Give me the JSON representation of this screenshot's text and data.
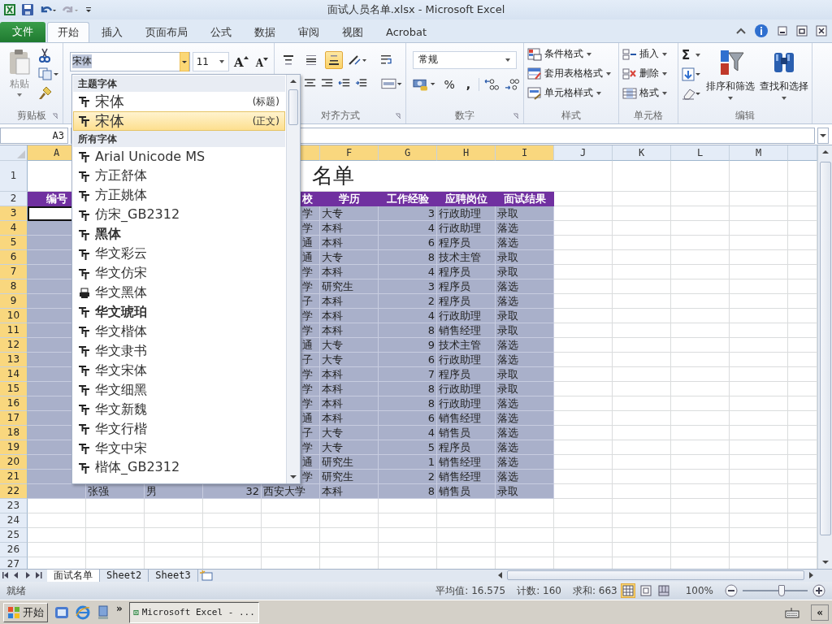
{
  "window": {
    "title": "面试人员名单.xlsx - Microsoft Excel"
  },
  "ribbon_tabs": [
    {
      "label": "文件",
      "kind": "file",
      "selected": false
    },
    {
      "label": "开始",
      "kind": "tab",
      "selected": true
    },
    {
      "label": "插入",
      "kind": "tab",
      "selected": false
    },
    {
      "label": "页面布局",
      "kind": "tab",
      "selected": false
    },
    {
      "label": "公式",
      "kind": "tab",
      "selected": false
    },
    {
      "label": "数据",
      "kind": "tab",
      "selected": false
    },
    {
      "label": "审阅",
      "kind": "tab",
      "selected": false
    },
    {
      "label": "视图",
      "kind": "tab",
      "selected": false
    },
    {
      "label": "Acrobat",
      "kind": "tab",
      "selected": false
    }
  ],
  "ribbon": {
    "clipboard": {
      "paste": "粘贴",
      "label": "剪贴板"
    },
    "font": {
      "name": "宋体",
      "size": "11",
      "grow": "A",
      "shrink": "A"
    },
    "alignment": {
      "label": "对齐方式",
      "vertical": [
        {
          "kind": "top",
          "selected": false
        },
        {
          "kind": "middle",
          "selected": false
        },
        {
          "kind": "bottom",
          "selected": true
        }
      ]
    },
    "number": {
      "label": "数字",
      "format": "常规",
      "percent": "%",
      "comma": ","
    },
    "styles": {
      "label": "样式",
      "buttons": [
        {
          "kind": "conditional",
          "label": "条件格式"
        },
        {
          "kind": "table",
          "label": "套用表格格式"
        },
        {
          "kind": "cell",
          "label": "单元格样式"
        }
      ]
    },
    "cells": {
      "label": "单元格",
      "buttons": [
        {
          "kind": "insert",
          "label": "插入"
        },
        {
          "kind": "delete",
          "label": "删除"
        },
        {
          "kind": "format",
          "label": "格式"
        }
      ]
    },
    "editing": {
      "label": "编辑",
      "sum": "Σ",
      "sort": "排序和筛选",
      "find": "查找和选择"
    }
  },
  "formula_bar": {
    "name_box": "A3"
  },
  "sheet": {
    "columns": [
      {
        "label": "A",
        "selected": true
      },
      {
        "label": "F",
        "selected": true
      },
      {
        "label": "G",
        "selected": true
      },
      {
        "label": "H",
        "selected": true
      },
      {
        "label": "I",
        "selected": true
      },
      {
        "label": "J",
        "selected": false
      },
      {
        "label": "K",
        "selected": false
      },
      {
        "label": "L",
        "selected": false
      },
      {
        "label": "M",
        "selected": false
      }
    ],
    "rows": [
      {
        "label": "1",
        "kind": "title",
        "selected": false,
        "title": "名单"
      },
      {
        "label": "2",
        "kind": "header",
        "selected": false,
        "number": "编号",
        "school": "校",
        "education": "学历",
        "experience": "工作经验",
        "position": "应聘岗位",
        "result": "面试结果"
      },
      {
        "label": "3",
        "kind": "data",
        "selected": true,
        "active": true,
        "school": "学",
        "education": "大专",
        "experience": "3",
        "position": "行政助理",
        "result": "录取"
      },
      {
        "label": "4",
        "kind": "data",
        "selected": true,
        "school": "学",
        "education": "本科",
        "experience": "4",
        "position": "行政助理",
        "result": "落选"
      },
      {
        "label": "5",
        "kind": "data",
        "selected": true,
        "school": "通",
        "education": "本科",
        "experience": "6",
        "position": "程序员",
        "result": "落选"
      },
      {
        "label": "6",
        "kind": "data",
        "selected": true,
        "school": "通",
        "education": "大专",
        "experience": "8",
        "position": "技术主管",
        "result": "录取"
      },
      {
        "label": "7",
        "kind": "data",
        "selected": true,
        "school": "学",
        "education": "本科",
        "experience": "4",
        "position": "程序员",
        "result": "录取"
      },
      {
        "label": "8",
        "kind": "data",
        "selected": true,
        "school": "学",
        "education": "研究生",
        "experience": "3",
        "position": "程序员",
        "result": "落选"
      },
      {
        "label": "9",
        "kind": "data",
        "selected": true,
        "school": "子",
        "education": "本科",
        "experience": "2",
        "position": "程序员",
        "result": "落选"
      },
      {
        "label": "10",
        "kind": "data",
        "selected": true,
        "school": "学",
        "education": "本科",
        "experience": "4",
        "position": "行政助理",
        "result": "录取"
      },
      {
        "label": "11",
        "kind": "data",
        "selected": true,
        "school": "学",
        "education": "本科",
        "experience": "8",
        "position": "销售经理",
        "result": "录取"
      },
      {
        "label": "12",
        "kind": "data",
        "selected": true,
        "school": "通",
        "education": "大专",
        "experience": "9",
        "position": "技术主管",
        "result": "落选"
      },
      {
        "label": "13",
        "kind": "data",
        "selected": true,
        "school": "子",
        "education": "大专",
        "experience": "6",
        "position": "行政助理",
        "result": "落选"
      },
      {
        "label": "14",
        "kind": "data",
        "selected": true,
        "school": "学",
        "education": "本科",
        "experience": "7",
        "position": "程序员",
        "result": "录取"
      },
      {
        "label": "15",
        "kind": "data",
        "selected": true,
        "school": "学",
        "education": "本科",
        "experience": "8",
        "position": "行政助理",
        "result": "录取"
      },
      {
        "label": "16",
        "kind": "data",
        "selected": true,
        "school": "学",
        "education": "本科",
        "experience": "8",
        "position": "行政助理",
        "result": "落选"
      },
      {
        "label": "17",
        "kind": "data",
        "selected": true,
        "school": "通",
        "education": "本科",
        "experience": "6",
        "position": "销售经理",
        "result": "落选"
      },
      {
        "label": "18",
        "kind": "data",
        "selected": true,
        "school": "子",
        "education": "大专",
        "experience": "4",
        "position": "销售员",
        "result": "落选"
      },
      {
        "label": "19",
        "kind": "data",
        "selected": true,
        "school": "学",
        "education": "大专",
        "experience": "5",
        "position": "程序员",
        "result": "落选"
      },
      {
        "label": "20",
        "kind": "data",
        "selected": true,
        "school": "通",
        "education": "研究生",
        "experience": "1",
        "position": "销售经理",
        "result": "落选"
      },
      {
        "label": "21",
        "kind": "data",
        "selected": true,
        "school": "学",
        "education": "研究生",
        "experience": "2",
        "position": "销售经理",
        "result": "落选"
      },
      {
        "label": "22",
        "kind": "data",
        "selected": true,
        "name": "张强",
        "gender": "男",
        "age": "32",
        "school": "西安大学",
        "education": "本科",
        "experience": "8",
        "position": "销售员",
        "result": "录取"
      },
      {
        "label": "23",
        "kind": "empty",
        "selected": false
      },
      {
        "label": "24",
        "kind": "empty",
        "selected": false
      },
      {
        "label": "25",
        "kind": "empty",
        "selected": false
      },
      {
        "label": "26",
        "kind": "empty",
        "selected": false
      },
      {
        "label": "27",
        "kind": "empty",
        "selected": false
      }
    ]
  },
  "font_dropdown": {
    "sections": [
      {
        "title": "主题字体",
        "items": [
          {
            "name": "宋体",
            "note": "(标题)",
            "kind": "truetype",
            "bold": false,
            "selected": false
          },
          {
            "name": "宋体",
            "note": "(正文)",
            "kind": "truetype",
            "bold": false,
            "selected": true
          }
        ]
      },
      {
        "title": "所有字体",
        "items": [
          {
            "name": "Arial Unicode MS",
            "kind": "truetype",
            "bold": false,
            "selected": false
          },
          {
            "name": "方正舒体",
            "kind": "truetype",
            "bold": false,
            "selected": false
          },
          {
            "name": "方正姚体",
            "kind": "truetype",
            "bold": false,
            "selected": false
          },
          {
            "name": "仿宋_GB2312",
            "kind": "truetype",
            "bold": false,
            "selected": false
          },
          {
            "name": "黑体",
            "kind": "truetype",
            "bold": true,
            "selected": false
          },
          {
            "name": "华文彩云",
            "kind": "truetype",
            "bold": false,
            "selected": false
          },
          {
            "name": "华文仿宋",
            "kind": "truetype",
            "bold": false,
            "selected": false
          },
          {
            "name": "华文黑体",
            "kind": "printer",
            "bold": false,
            "selected": false
          },
          {
            "name": "华文琥珀",
            "kind": "truetype",
            "bold": true,
            "selected": false
          },
          {
            "name": "华文楷体",
            "kind": "truetype",
            "bold": false,
            "selected": false
          },
          {
            "name": "华文隶书",
            "kind": "truetype",
            "bold": false,
            "selected": false
          },
          {
            "name": "华文宋体",
            "kind": "truetype",
            "bold": false,
            "selected": false
          },
          {
            "name": "华文细黑",
            "kind": "truetype",
            "bold": false,
            "selected": false
          },
          {
            "name": "华文新魏",
            "kind": "truetype",
            "bold": false,
            "selected": false
          },
          {
            "name": "华文行楷",
            "kind": "truetype",
            "bold": false,
            "selected": false
          },
          {
            "name": "华文中宋",
            "kind": "truetype",
            "bold": false,
            "selected": false
          },
          {
            "name": "楷体_GB2312",
            "kind": "truetype",
            "bold": false,
            "selected": false
          }
        ]
      }
    ]
  },
  "sheet_tabs": [
    {
      "label": "面试名单",
      "selected": true
    },
    {
      "label": "Sheet2",
      "selected": false
    },
    {
      "label": "Sheet3",
      "selected": false
    }
  ],
  "status_bar": {
    "ready": "就绪",
    "average": "平均值: 16.575",
    "count": "计数: 160",
    "sum": "求和: 663",
    "views": [
      {
        "kind": "normal",
        "selected": true
      },
      {
        "kind": "layout",
        "selected": false
      },
      {
        "kind": "pagebreak",
        "selected": false
      }
    ],
    "zoom": "100%",
    "zoom_slider": {
      "level": 0.6
    }
  },
  "taskbar": {
    "start": "开始",
    "more": "»",
    "tasks": [
      {
        "label": "Microsoft Excel - ...",
        "selected": true
      }
    ],
    "collapse": "«"
  }
}
